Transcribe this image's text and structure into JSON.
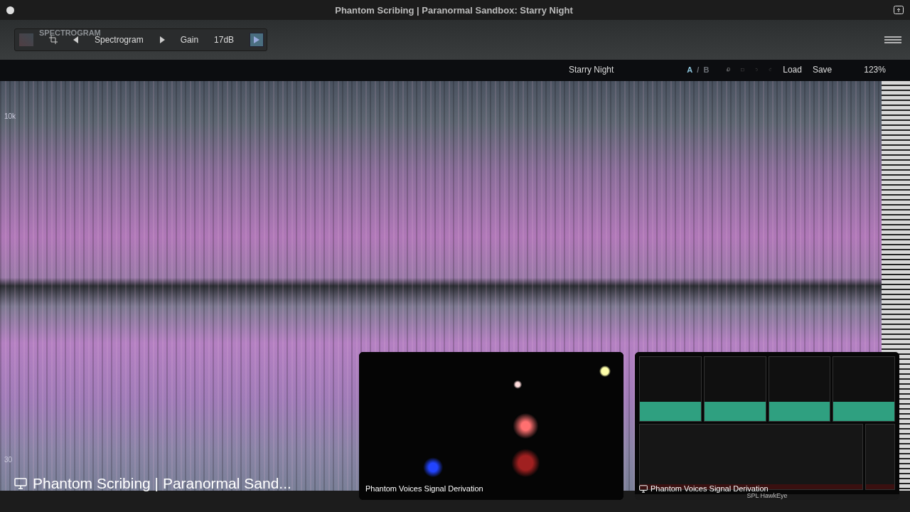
{
  "window": {
    "title": "Phantom Scribing | Paranormal Sandbox: Starry Night"
  },
  "toolbar": {
    "plugin_name": "SPECTROGRAM",
    "view": "Spectrogram",
    "gain_label": "Gain",
    "gain_value": "17dB"
  },
  "preset_bar": {
    "preset": "Starry Night",
    "ab_separator": "/",
    "ab": [
      {
        "label": "A",
        "selected": true
      },
      {
        "label": "B",
        "selected": false
      }
    ],
    "load": "Load",
    "save": "Save",
    "zoom": "123%"
  },
  "spectrogram": {
    "freq_labels": [
      "10k",
      "30"
    ]
  },
  "screen_share": {
    "label": "Phantom Scribing | Paranormal Sand..."
  },
  "tiles": [
    {
      "kind": "camera",
      "label": "Phantom Voices Signal Derivation"
    },
    {
      "kind": "screen",
      "label": "Phantom Voices Signal Derivation",
      "caption": "SPL HawkEye"
    }
  ]
}
